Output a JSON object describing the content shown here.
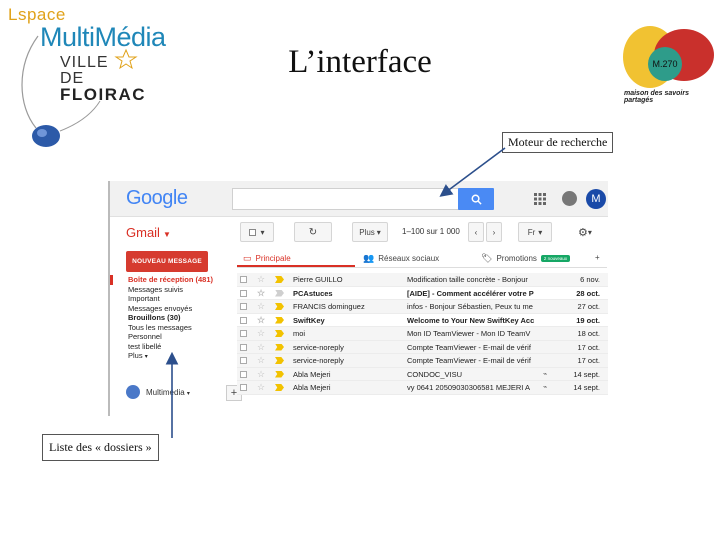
{
  "slide": {
    "title": "L’interface",
    "callout_search": "Moteur de recherche",
    "callout_folders": "Liste des « dossiers »"
  },
  "branding_left": {
    "espace": "Lspace",
    "multimedia": "MultiMédia",
    "ville": "VILLE",
    "de": "DE",
    "floirac": "FLOIRAC"
  },
  "branding_right": {
    "badge": "M.270",
    "caption": "maison des savoirs partagés"
  },
  "colors": {
    "gmail_red": "#d93025",
    "search_blue": "#4a8af4",
    "compose_red": "#d63b2f",
    "important_yellow": "#f2c200",
    "promo_green": "#16a765"
  },
  "gmail": {
    "logo": "Google",
    "account_initial": "M",
    "label": "Gmail",
    "toolbar": {
      "more": "Plus",
      "range": "1–100 sur 1 000",
      "lang": "Fr"
    },
    "compose": "NOUVEAU MESSAGE",
    "nav": [
      "Boîte de réception (481)",
      "Messages suivis",
      "Important",
      "Messages envoyés",
      "Brouillons (30)",
      "Tous les messages",
      "Personnel",
      "test libellé",
      "Plus"
    ],
    "hangout_name": "Multimédia",
    "hangout_add": "+",
    "tabs": [
      {
        "label": "Principale",
        "icon": "inbox-icon"
      },
      {
        "label": "Réseaux sociaux",
        "icon": "people-icon"
      },
      {
        "label": "Promotions",
        "icon": "tag-icon",
        "badge": "2 nouveaux"
      }
    ],
    "emails": [
      {
        "sender": "Pierre GUILLO",
        "subject": "Modification taille concrète - Bonjour",
        "date": "6 nov.",
        "important": true,
        "unread": false,
        "attach": ""
      },
      {
        "sender": "PCAstuces",
        "subject": "[AIDE] - Comment accélérer votre P",
        "date": "28 oct.",
        "important": false,
        "unread": true,
        "attach": ""
      },
      {
        "sender": "FRANCIS dominguez",
        "subject": "infos - Bonjour Sébastien, Peux tu me",
        "date": "27 oct.",
        "important": true,
        "unread": false,
        "attach": ""
      },
      {
        "sender": "SwiftKey",
        "subject": "Welcome to Your New SwiftKey Acc",
        "date": "19 oct.",
        "important": true,
        "unread": true,
        "attach": ""
      },
      {
        "sender": "moi",
        "subject": "Mon ID TeamViewer - Mon ID TeamV",
        "date": "18 oct.",
        "important": true,
        "unread": false,
        "attach": ""
      },
      {
        "sender": "service-noreply",
        "subject": "Compte TeamViewer - E-mail de vérif",
        "date": "17 oct.",
        "important": true,
        "unread": false,
        "attach": ""
      },
      {
        "sender": "service-noreply",
        "subject": "Compte TeamViewer - E-mail de vérif",
        "date": "17 oct.",
        "important": true,
        "unread": false,
        "attach": ""
      },
      {
        "sender": "Abla Mejeri",
        "subject": "CONDOC_VISU",
        "date": "14 sept.",
        "important": true,
        "unread": false,
        "attach": "⌁"
      },
      {
        "sender": "Abla Mejeri",
        "subject": "vy 0641 20509030306581 MEJERI A",
        "date": "14 sept.",
        "important": true,
        "unread": false,
        "attach": "⌁"
      }
    ]
  }
}
